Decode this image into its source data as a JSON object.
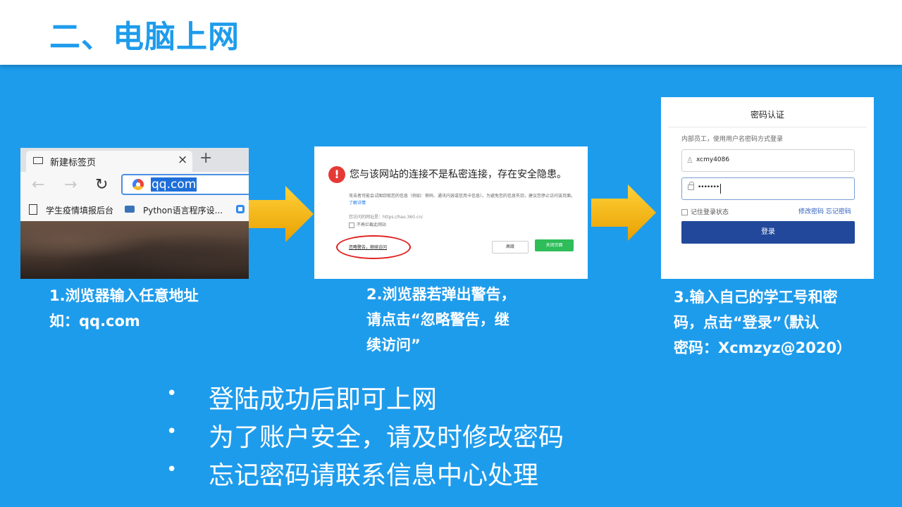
{
  "header": {
    "title": "二、电脑上网"
  },
  "step1": {
    "tab_label": "新建标签页",
    "tab_close": "×",
    "tab_new": "+",
    "nav_back": "←",
    "nav_forward": "→",
    "nav_reload": "↻",
    "address_value": "qq.com",
    "bookmark1": "学生疫情填报后台",
    "bookmark2": "Python语言程序设...",
    "caption_lines": [
      "1.浏览器输入任意地址",
      "如：qq.com"
    ]
  },
  "step2": {
    "warning_title": "您与该网站的连接不是私密连接，存在安全隐患。",
    "warning_body": "攻击者可能会试图窃取您的信息（例如：密码、通讯内容或信用卡信息）。为避免您的信息失窃，建议您停止访问该页面。",
    "warning_link": "了解详情",
    "warning_url": "您访问的网址是：https://hao.360.cn/",
    "warning_checkbox": "不再拦截此网站",
    "ignore_link": "忽略警告，继续访问",
    "advanced_button": "高级",
    "close_button": "关闭页面",
    "caption_lines": [
      "2.浏览器若弹出警告，",
      "请点击“忽略警告，继",
      "续访问”"
    ]
  },
  "step3": {
    "title": "密码认证",
    "subtitle": "内部员工，使用用户名密码方式登录",
    "username_value": "xcmy4086",
    "password_value": "•••••••",
    "remember_label": "记住登录状态",
    "change_password": "修改密码",
    "forgot_password": "忘记密码",
    "login_button": "登录",
    "caption_lines": [
      "3.输入自己的学工号和密",
      "码，点击“登录”（默认",
      "密码：Xcmzyz@2020）"
    ]
  },
  "bullets": [
    {
      "dot": "•",
      "text": "登陆成功后即可上网"
    },
    {
      "dot": "•",
      "text": "为了账户安全，请及时修改密码"
    },
    {
      "dot": "•",
      "text": "忘记密码请联系信息中心处理"
    }
  ],
  "colors": {
    "background": "#1e9cec",
    "title": "#1e9cec",
    "arrow": "#f6b600",
    "login_button": "#21489a",
    "close_button": "#2ebd59",
    "warning_red": "#e53935"
  }
}
